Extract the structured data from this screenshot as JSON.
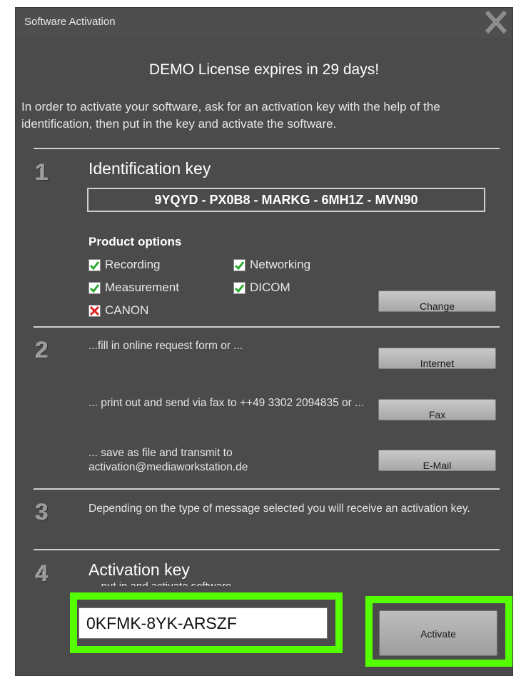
{
  "window": {
    "title": "Software Activation",
    "close_icon": "close-icon"
  },
  "heading": "DEMO License expires in 29 days!",
  "intro": "In order to activate your software, ask for an activation key with the help of the identification, then put in the key and activate the software.",
  "step1": {
    "number": "1",
    "title": "Identification key",
    "id_key": "9YQYD - PX0B8 - MARKG - 6MH1Z - MVN90",
    "options_title": "Product options",
    "options": [
      {
        "label": "Recording",
        "checked": true
      },
      {
        "label": "Networking",
        "checked": true
      },
      {
        "label": "Measurement",
        "checked": true
      },
      {
        "label": "DICOM",
        "checked": true
      },
      {
        "label": "CANON",
        "checked": false
      }
    ],
    "change_label": "Change"
  },
  "step2": {
    "number": "2",
    "online_text": "...fill in online request form or ...",
    "internet_label": "Internet",
    "fax_text": "... print out and send via fax to ++49 3302 2094835 or ...",
    "fax_label": "Fax",
    "email_text": "... save as file and transmit to activation@mediaworkstation.de",
    "email_label": "E-Mail"
  },
  "step3": {
    "number": "3",
    "text": "Depending on the type of message selected you will receive an activation key."
  },
  "step4": {
    "number": "4",
    "title": "Activation key",
    "hint": "... put in and activate software ...",
    "key_value": "0KFMK-8YK-ARSZF",
    "activate_label": "Activate"
  },
  "colors": {
    "highlight": "#55ff00",
    "window_bg": "#4b4b4b",
    "check_green": "#2ea82e",
    "cross_red": "#e02020"
  }
}
